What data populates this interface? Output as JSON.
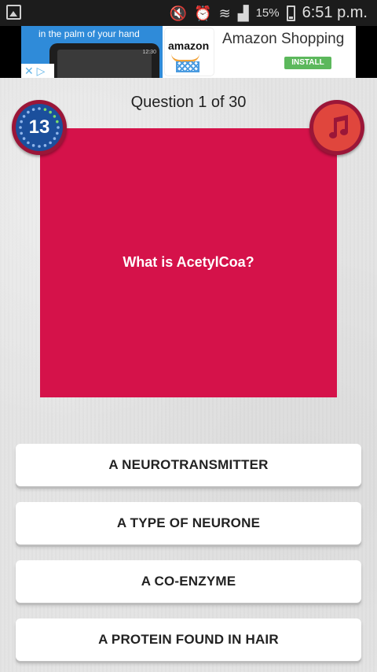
{
  "status_bar": {
    "battery_percent": "15%",
    "time": "6:51 p.m."
  },
  "ad": {
    "phone_caption": "in the palm of your hand",
    "phone_time": "12:30",
    "brand": "amazon",
    "title": "Amazon Shopping",
    "install_label": "INSTALL"
  },
  "quiz": {
    "question_counter": "Question 1 of 30",
    "timer_value": "13",
    "question_text": "What is AcetylCoa?",
    "answers": [
      "A NEUROTRANSMITTER",
      "A TYPE OF NEURONE",
      "A CO-ENZYME",
      "A PROTEIN FOUND IN HAIR"
    ]
  },
  "colors": {
    "card": "#d5124a",
    "timer": "#1b4f9c",
    "music": "#e0463d",
    "ring": "#9b1638"
  }
}
